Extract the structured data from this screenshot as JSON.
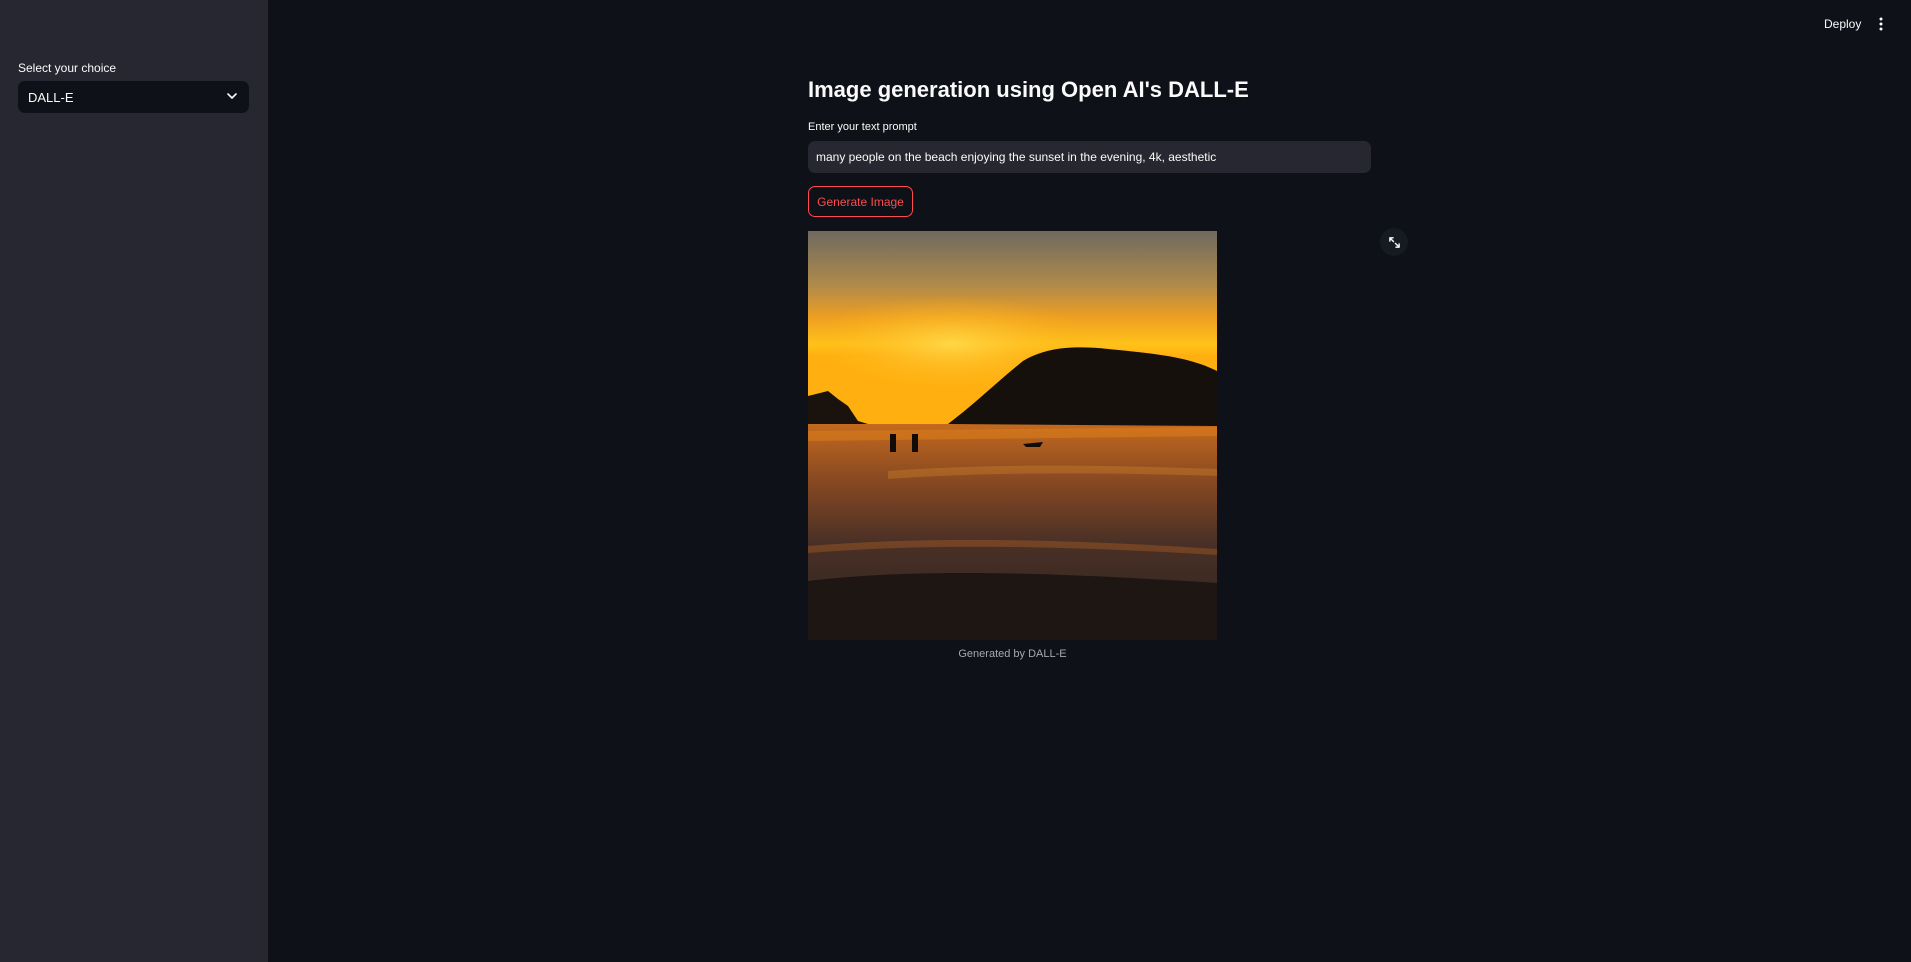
{
  "sidebar": {
    "select_label": "Select your choice",
    "selected_value": "DALL-E"
  },
  "topbar": {
    "deploy_label": "Deploy"
  },
  "main": {
    "title": "Image generation using Open AI's DALL-E",
    "prompt_label": "Enter your text prompt",
    "prompt_value": "many people on the beach enjoying the sunset in the evening, 4k, aesthetic",
    "generate_button_label": "Generate Image",
    "image_caption": "Generated by DALL-E"
  },
  "colors": {
    "background": "#0e1117",
    "sidebar": "#262730",
    "accent": "#ff4b4b"
  },
  "icons": {
    "select": "chevron-down-icon",
    "menu": "vertical-dots-icon",
    "fullscreen": "expand-icon"
  }
}
